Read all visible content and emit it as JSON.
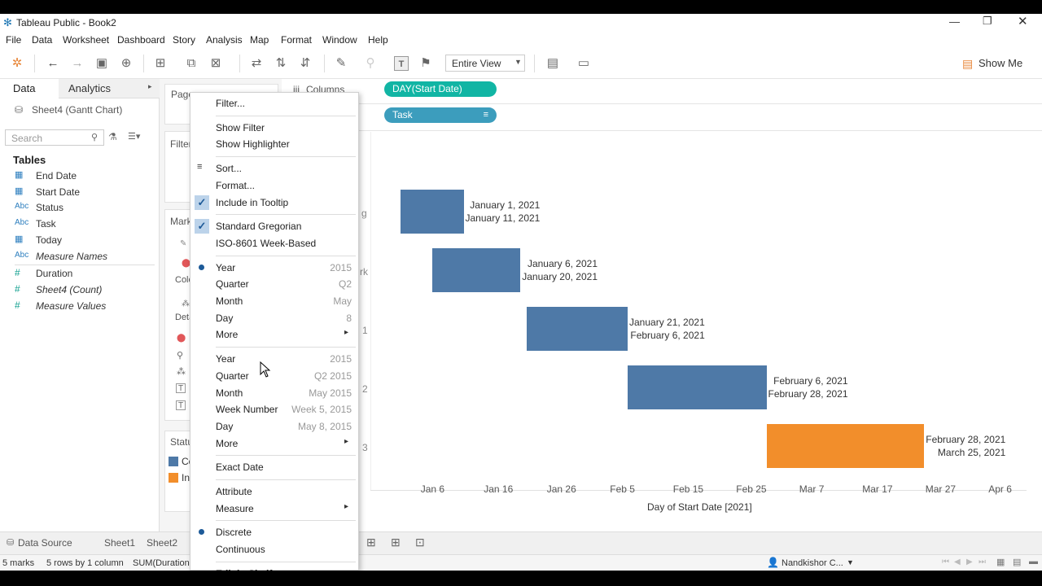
{
  "window": {
    "title": "Tableau Public - Book2"
  },
  "menubar": [
    "File",
    "Data",
    "Worksheet",
    "Dashboard",
    "Story",
    "Analysis",
    "Map",
    "Format",
    "Window",
    "Help"
  ],
  "toolbar": {
    "fit": "Entire View",
    "show_me": "Show Me"
  },
  "leftpane": {
    "tab_data": "Data",
    "tab_analytics": "Analytics",
    "datasource": "Sheet4 (Gantt Chart)",
    "search_placeholder": "Search",
    "tables_header": "Tables",
    "fields": [
      {
        "icon": "calendar-icon",
        "glyph": "▦",
        "name": "End Date",
        "italic": false
      },
      {
        "icon": "calendar-icon",
        "glyph": "▦",
        "name": "Start Date",
        "italic": false
      },
      {
        "icon": "abc-icon",
        "glyph": "Abc",
        "name": "Status",
        "italic": false
      },
      {
        "icon": "abc-icon",
        "glyph": "Abc",
        "name": "Task",
        "italic": false
      },
      {
        "icon": "calendar-icon",
        "glyph": "▦",
        "name": "Today",
        "italic": false
      },
      {
        "icon": "abc-icon",
        "glyph": "Abc",
        "name": "Measure Names",
        "italic": true
      },
      {
        "icon": "hash-icon",
        "glyph": "#",
        "name": "Duration",
        "italic": false
      },
      {
        "icon": "hash-icon",
        "glyph": "#",
        "name": "Sheet4 (Count)",
        "italic": true
      },
      {
        "icon": "hash-icon",
        "glyph": "#",
        "name": "Measure Values",
        "italic": true
      }
    ]
  },
  "shelves": {
    "pages": "Pages",
    "filters": "Filter",
    "marks": "Mark",
    "color": "Colo",
    "detail": "Deta",
    "status_legend": "Statu",
    "columns": "Columns",
    "columns_pill": "DAY(Start Date)",
    "rows_pill": "Task",
    "legend_items": [
      "Co",
      "In"
    ]
  },
  "rowlabels": [
    "g",
    "rk",
    "1",
    "2",
    "3"
  ],
  "context_menu": [
    {
      "type": "item",
      "label": "Filter..."
    },
    {
      "type": "sep"
    },
    {
      "type": "item",
      "label": "Show Filter"
    },
    {
      "type": "item",
      "label": "Show Highlighter"
    },
    {
      "type": "sep"
    },
    {
      "type": "item",
      "label": "Sort...",
      "icon": "sort-icon"
    },
    {
      "type": "item",
      "label": "Format..."
    },
    {
      "type": "item",
      "label": "Include in Tooltip",
      "check": true
    },
    {
      "type": "sep"
    },
    {
      "type": "item",
      "label": "Standard Gregorian",
      "check": true
    },
    {
      "type": "item",
      "label": "ISO-8601 Week-Based"
    },
    {
      "type": "sep"
    },
    {
      "type": "item",
      "label": "Year",
      "right": "2015",
      "dot": true
    },
    {
      "type": "item",
      "label": "Quarter",
      "right": "Q2"
    },
    {
      "type": "item",
      "label": "Month",
      "right": "May"
    },
    {
      "type": "item",
      "label": "Day",
      "right": "8"
    },
    {
      "type": "item",
      "label": "More",
      "submenu": true
    },
    {
      "type": "sep"
    },
    {
      "type": "item",
      "label": "Year",
      "right": "2015"
    },
    {
      "type": "item",
      "label": "Quarter",
      "right": "Q2 2015"
    },
    {
      "type": "item",
      "label": "Month",
      "right": "May 2015"
    },
    {
      "type": "item",
      "label": "Week Number",
      "right": "Week 5, 2015"
    },
    {
      "type": "item",
      "label": "Day",
      "right": "May 8, 2015"
    },
    {
      "type": "item",
      "label": "More",
      "submenu": true
    },
    {
      "type": "sep"
    },
    {
      "type": "item",
      "label": "Exact Date"
    },
    {
      "type": "sep"
    },
    {
      "type": "item",
      "label": "Attribute"
    },
    {
      "type": "item",
      "label": "Measure",
      "submenu": true
    },
    {
      "type": "sep"
    },
    {
      "type": "item",
      "label": "Discrete",
      "dot": true
    },
    {
      "type": "item",
      "label": "Continuous"
    },
    {
      "type": "sep"
    },
    {
      "type": "item",
      "label": "Edit in Shelf",
      "bold": true
    }
  ],
  "chart_data": {
    "type": "gantt",
    "xlabel": "Day of Start Date [2021]",
    "ticks": [
      "Jan 6",
      "Jan 16",
      "Jan 26",
      "Feb 5",
      "Feb 15",
      "Feb 25",
      "Mar 7",
      "Mar 17",
      "Mar 27",
      "Apr 6"
    ],
    "tasks": [
      {
        "start": "2021-01-01",
        "end": "2021-01-11",
        "start_label": "January 1, 2021",
        "end_label": "January 11, 2021",
        "status": "Co",
        "color": "#4e79a7"
      },
      {
        "start": "2021-01-06",
        "end": "2021-01-20",
        "start_label": "January 6, 2021",
        "end_label": "January 20, 2021",
        "status": "Co",
        "color": "#4e79a7"
      },
      {
        "start": "2021-01-21",
        "end": "2021-02-06",
        "start_label": "January 21, 2021",
        "end_label": "February 6, 2021",
        "status": "Co",
        "color": "#4e79a7"
      },
      {
        "start": "2021-02-06",
        "end": "2021-02-28",
        "start_label": "February 6, 2021",
        "end_label": "February 28, 2021",
        "status": "Co",
        "color": "#4e79a7"
      },
      {
        "start": "2021-02-28",
        "end": "2021-03-25",
        "start_label": "February 28, 2021",
        "end_label": "March 25, 2021",
        "status": "In",
        "color": "#f28e2b"
      }
    ]
  },
  "colors": {
    "completed": "#4e79a7",
    "in_progress": "#f28e2b",
    "columns_pill": "#11b5a4",
    "rows_pill": "#3c9dbd"
  },
  "tabs": {
    "datasource": "Data Source",
    "sheets": [
      "Sheet1",
      "Sheet2"
    ]
  },
  "status": {
    "marks": "5 marks",
    "rows": "5 rows by 1 column",
    "sum": "SUM(Duration",
    "user": "Nandkishor C..."
  }
}
